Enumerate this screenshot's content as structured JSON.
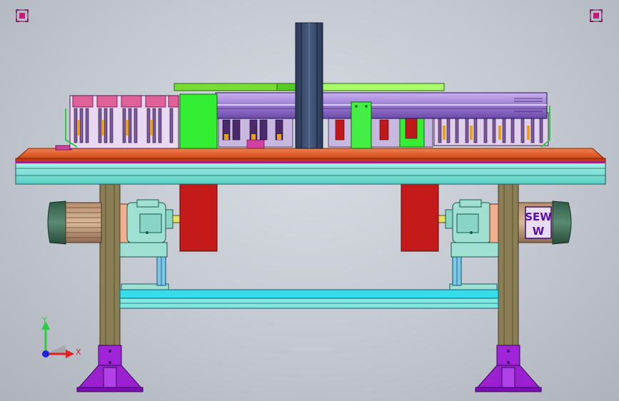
{
  "viewport": {
    "background": "#c8ccd3",
    "corner_handles": [
      {
        "name": "corner-handle-top-left",
        "icon": "fit-view-icon"
      },
      {
        "name": "corner-handle-top-right",
        "icon": "fit-view-icon"
      }
    ]
  },
  "model": {
    "motor_brand": {
      "line1": "SEW",
      "line2": "W"
    },
    "colors": {
      "frame_cyan": "#7fe0d6",
      "deck_orange": "#e8602a",
      "leg_olive": "#8a7e55",
      "foot_purple": "#a024d8",
      "red_block": "#c41a1a",
      "green_block": "#33ee33",
      "column_navy": "#3a4a6a",
      "rail_violet": "#a98ad8",
      "gearbox_teal": "#9fe0d2",
      "motor_green": "#3f6b55",
      "tie_bar_cyan": "#36dcea"
    }
  },
  "triad": {
    "x_label": "X",
    "y_label": "Y",
    "x_color": "#e02020",
    "y_color": "#2ecc40",
    "z_color": "#2020e0"
  }
}
